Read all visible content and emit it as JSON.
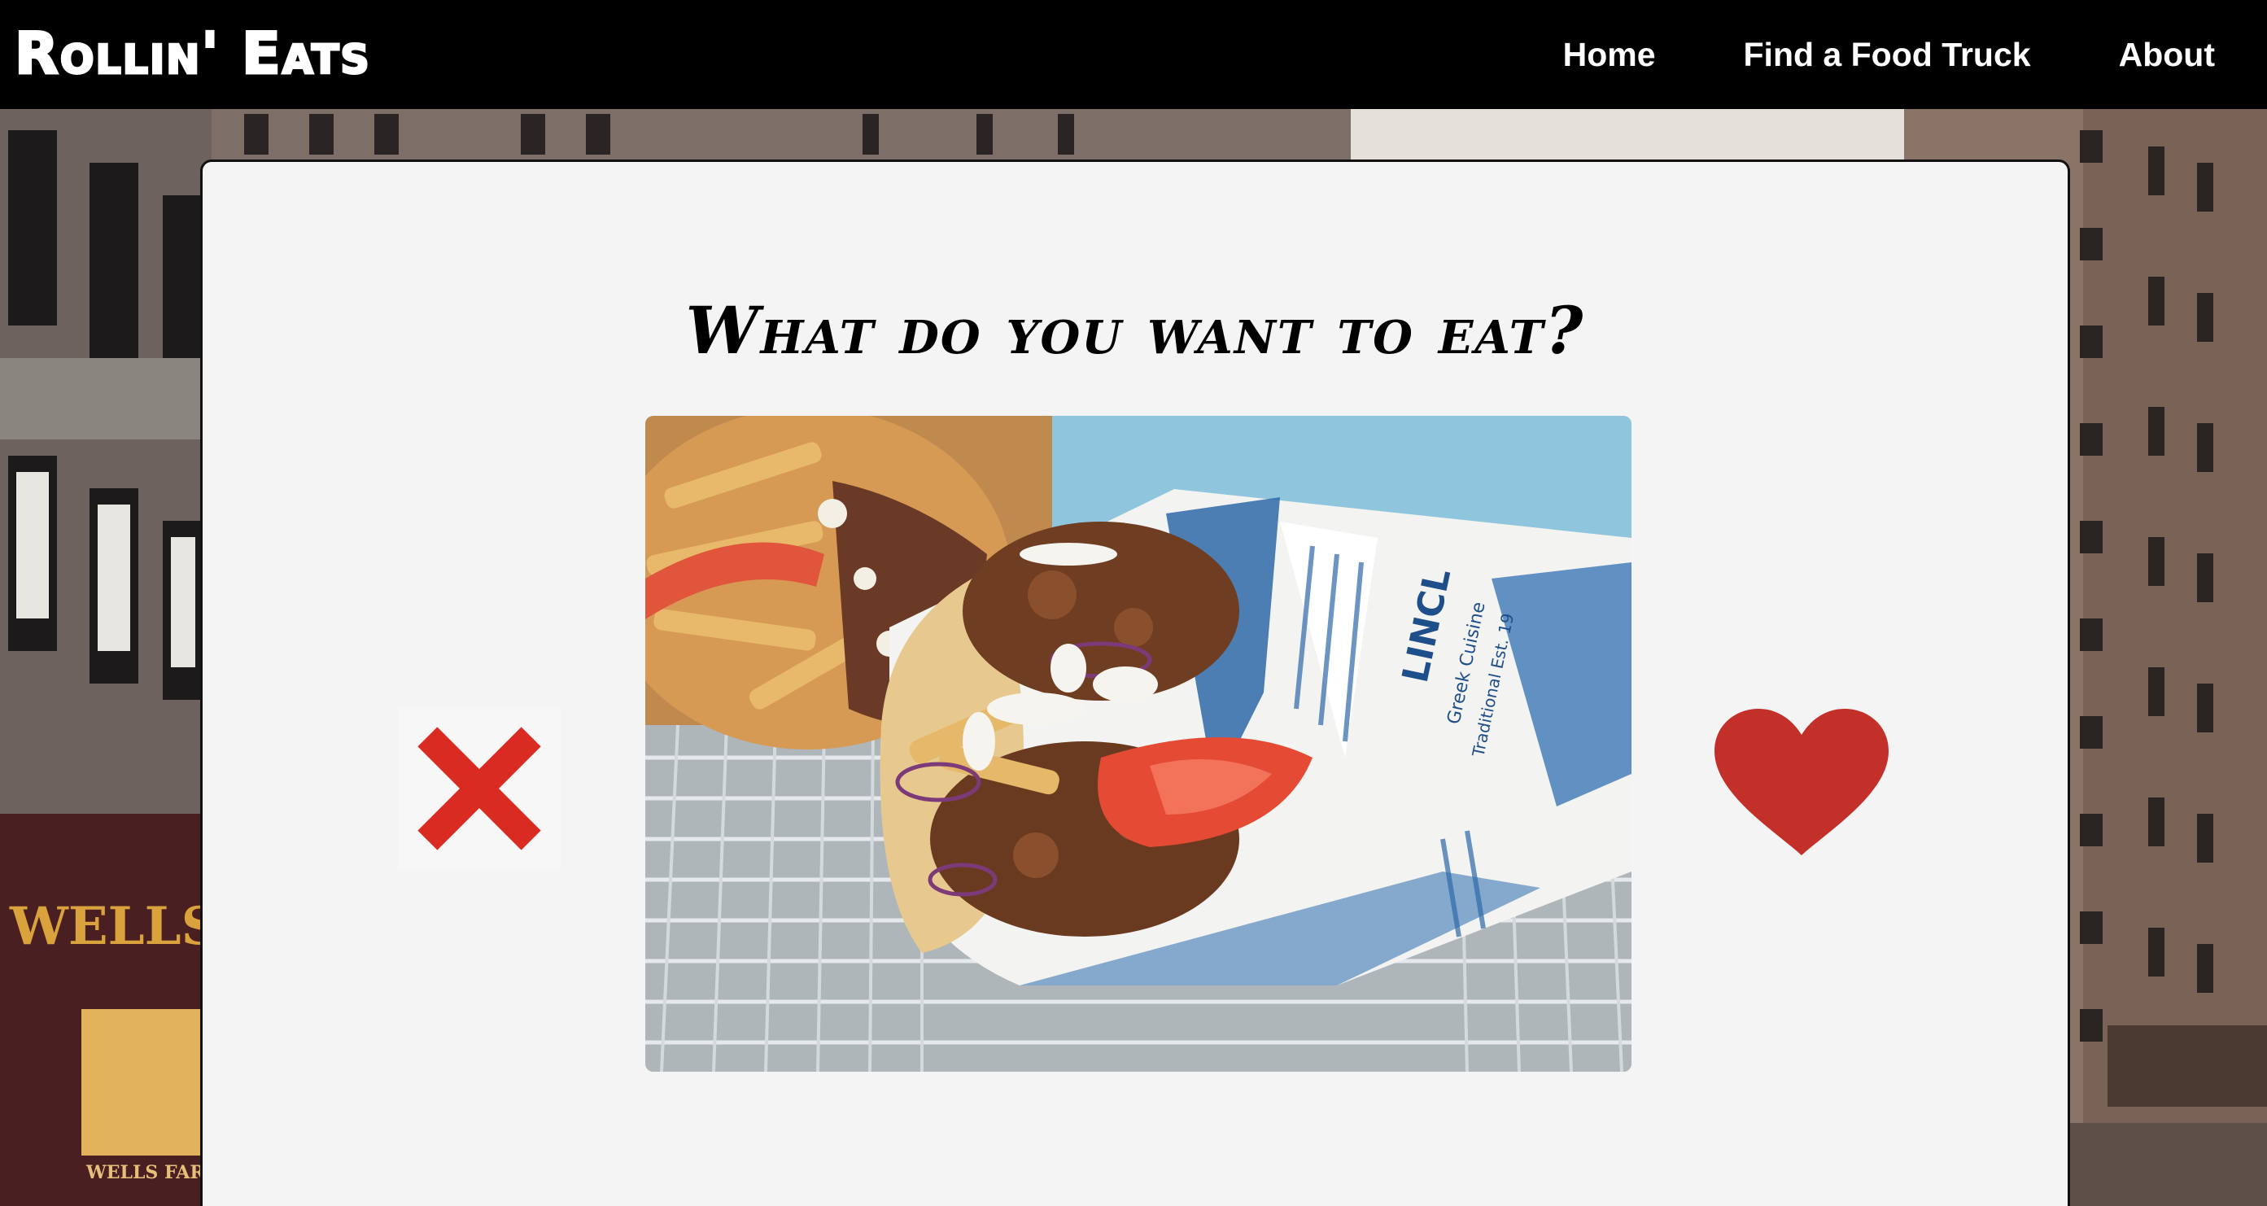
{
  "app": {
    "logo": "Rollin' Eats"
  },
  "nav": {
    "items": [
      {
        "label": "Home"
      },
      {
        "label": "Find a Food Truck"
      },
      {
        "label": "About"
      }
    ]
  },
  "main": {
    "question": "What do you want to eat?",
    "food_image": {
      "alt": "Falafel pita wrap with fries",
      "wrapper_text_1": "LINCL",
      "wrapper_text_2": "Greek Cuisine",
      "wrapper_text_3": "Traditional Est. 19"
    },
    "reject_icon": "close-icon",
    "like_icon": "heart-icon"
  },
  "background": {
    "sign_text": "WELLS",
    "sign_text_small": "WELLS FAR"
  },
  "colors": {
    "nav_background": "#000000",
    "card_background": "#f4f4f4",
    "reject_color": "#d92b22",
    "like_color": "#c3302a",
    "nav_text": "#ffffff"
  }
}
